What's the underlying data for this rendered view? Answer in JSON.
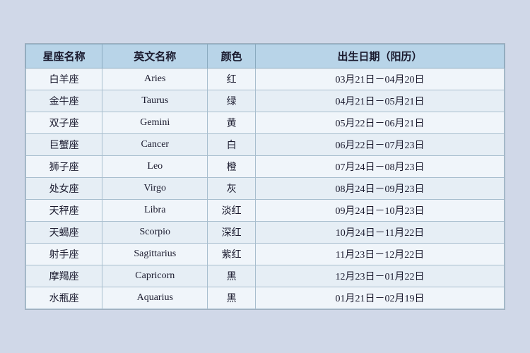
{
  "table": {
    "headers": [
      "星座名称",
      "英文名称",
      "颜色",
      "出生日期（阳历）"
    ],
    "rows": [
      {
        "chinese": "白羊座",
        "english": "Aries",
        "color": "红",
        "date": "03月21日－04月20日"
      },
      {
        "chinese": "金牛座",
        "english": "Taurus",
        "color": "绿",
        "date": "04月21日－05月21日"
      },
      {
        "chinese": "双子座",
        "english": "Gemini",
        "color": "黄",
        "date": "05月22日－06月21日"
      },
      {
        "chinese": "巨蟹座",
        "english": "Cancer",
        "color": "白",
        "date": "06月22日－07月23日"
      },
      {
        "chinese": "狮子座",
        "english": "Leo",
        "color": "橙",
        "date": "07月24日－08月23日"
      },
      {
        "chinese": "处女座",
        "english": "Virgo",
        "color": "灰",
        "date": "08月24日－09月23日"
      },
      {
        "chinese": "天秤座",
        "english": "Libra",
        "color": "淡红",
        "date": "09月24日－10月23日"
      },
      {
        "chinese": "天蝎座",
        "english": "Scorpio",
        "color": "深红",
        "date": "10月24日－11月22日"
      },
      {
        "chinese": "射手座",
        "english": "Sagittarius",
        "color": "紫红",
        "date": "11月23日－12月22日"
      },
      {
        "chinese": "摩羯座",
        "english": "Capricorn",
        "color": "黑",
        "date": "12月23日－01月22日"
      },
      {
        "chinese": "水瓶座",
        "english": "Aquarius",
        "color": "黑",
        "date": "01月21日－02月19日"
      }
    ]
  }
}
